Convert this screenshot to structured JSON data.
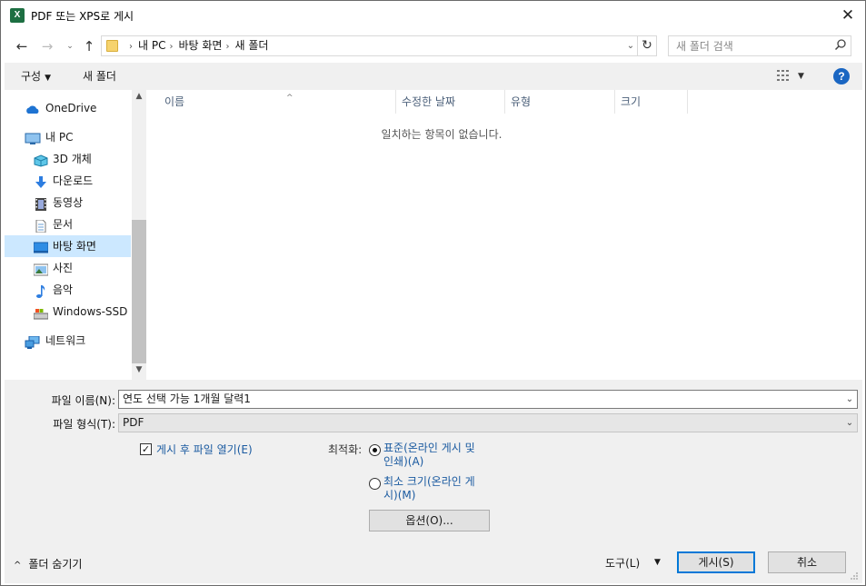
{
  "window": {
    "app_icon": "X",
    "title": "PDF 또는 XPS로 게시",
    "close_glyph": "✕"
  },
  "address": {
    "back_glyph": "←",
    "forward_glyph": "→",
    "recent_glyph": "⌄",
    "up_glyph": "↑",
    "crumbs": [
      "내 PC",
      "바탕 화면",
      "새 폴더"
    ],
    "crumb_sep": "›",
    "dropdown_glyph": "⌄",
    "refresh_glyph": "↻",
    "search_placeholder": "새 폴더 검색",
    "search_glyph": "⚲"
  },
  "toolbar": {
    "organize_label": "구성",
    "organize_caret": "▼",
    "new_folder_label": "새 폴더",
    "view_dd": "▼",
    "help_glyph": "?"
  },
  "nav": {
    "items": [
      {
        "label": "OneDrive",
        "icon": "onedrive-icon"
      },
      {
        "label": "내 PC",
        "icon": "pc-icon"
      },
      {
        "label": "3D 개체",
        "icon": "3d-objects-icon"
      },
      {
        "label": "다운로드",
        "icon": "download-icon"
      },
      {
        "label": "동영상",
        "icon": "videos-icon"
      },
      {
        "label": "문서",
        "icon": "documents-icon"
      },
      {
        "label": "바탕 화면",
        "icon": "desktop-icon",
        "selected": true
      },
      {
        "label": "사진",
        "icon": "pictures-icon"
      },
      {
        "label": "음악",
        "icon": "music-icon"
      },
      {
        "label": "Windows-SSD (",
        "icon": "drive-icon"
      },
      {
        "label": "네트워크",
        "icon": "network-icon"
      }
    ],
    "scroll_up": "▲",
    "scroll_down": "▼"
  },
  "filelist": {
    "columns": [
      "이름",
      "수정한 날짜",
      "유형",
      "크기"
    ],
    "sort_glyph": "^",
    "empty_message": "일치하는 항목이 없습니다."
  },
  "form": {
    "filename_label": "파일 이름(N):",
    "filename_value": "연도 선택 가능 1개월 달력1",
    "filetype_label": "파일 형식(T):",
    "filetype_value": "PDF",
    "dd_glyph": "⌄",
    "open_after_label": "게시 후 파일 열기(E)",
    "open_after_checked": "✓",
    "optimize_label": "최적화:",
    "standard_line1": "표준(온라인 게시 및",
    "standard_line2": "인쇄)(A)",
    "minimum_line1": "최소 크기(온라인 게",
    "minimum_line2": "시)(M)",
    "options_label": "옵션(O)...",
    "hide_folders_caret": "^",
    "hide_folders_label": "폴더 숨기기",
    "tools_label": "도구(L)",
    "tools_caret": "▼",
    "publish_label": "게시(S)",
    "cancel_label": "취소"
  }
}
